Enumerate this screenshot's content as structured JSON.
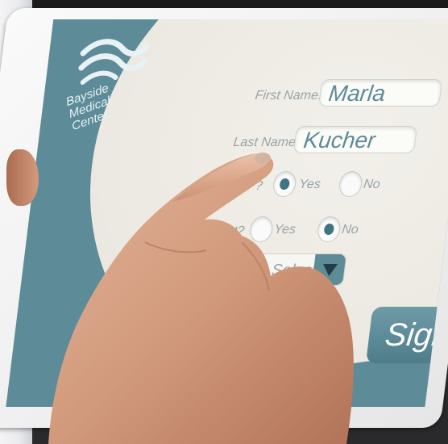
{
  "logo": {
    "icon": "wave-logo-icon",
    "lines": [
      "Bayside",
      "Medical",
      "Center"
    ]
  },
  "form": {
    "first_name": {
      "label": "First Name:",
      "value": "Marla"
    },
    "last_name": {
      "label": "Last Name:",
      "value": "Kucher"
    },
    "question1": {
      "label": "?",
      "options": [
        "Yes",
        "No"
      ],
      "selected": "Yes"
    },
    "question2": {
      "label": "ent?",
      "options": [
        "Yes",
        "No"
      ],
      "selected": "No"
    },
    "dropdown": {
      "value": "Select"
    },
    "sign_button": {
      "label": "Sign"
    }
  },
  "colors": {
    "accent": "#5d8b98",
    "screen_light": "#ece9e2",
    "label": "#9aa3a6",
    "skin": "#d8a286"
  }
}
